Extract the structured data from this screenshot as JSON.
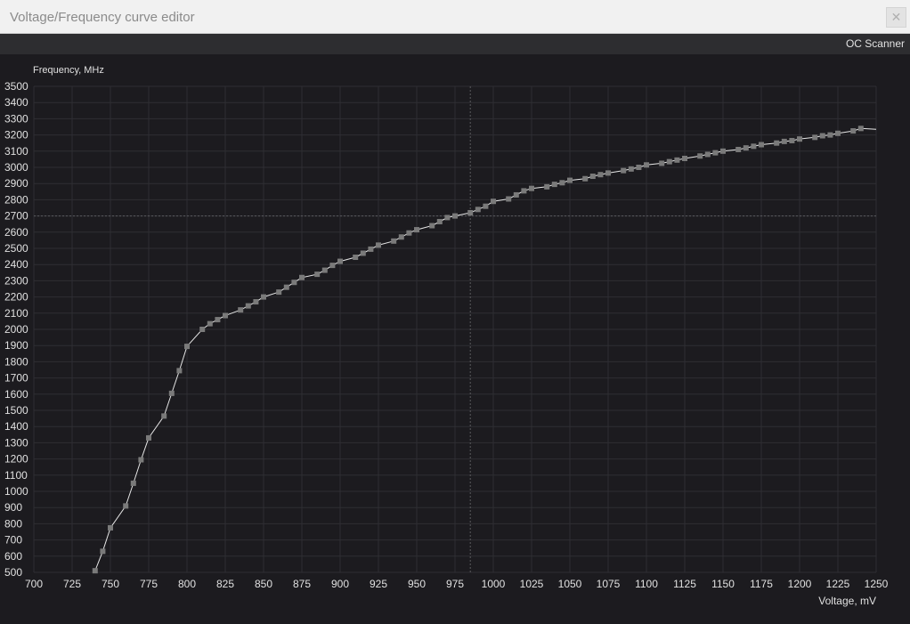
{
  "window": {
    "title": "Voltage/Frequency curve editor",
    "close_icon": "close-icon"
  },
  "toolbar": {
    "oc_scanner_label": "OC Scanner"
  },
  "colors": {
    "background": "#1c1b1f",
    "grid": "#2e2e33",
    "curve": "#e6e6e6",
    "point": "#7a7a7a",
    "crosshair": "#5a5a5e",
    "tick_text": "#e0e0e0"
  },
  "chart_data": {
    "type": "line",
    "ylabel": "Frequency, MHz",
    "xlabel": "Voltage, mV",
    "xlim": [
      700,
      1250
    ],
    "ylim": [
      500,
      3500
    ],
    "x_ticks": [
      700,
      725,
      750,
      775,
      800,
      825,
      850,
      875,
      900,
      925,
      950,
      975,
      1000,
      1025,
      1050,
      1075,
      1100,
      1125,
      1150,
      1175,
      1200,
      1225,
      1250
    ],
    "y_ticks": [
      500,
      600,
      700,
      800,
      900,
      1000,
      1100,
      1200,
      1300,
      1400,
      1500,
      1600,
      1700,
      1800,
      1900,
      2000,
      2100,
      2200,
      2300,
      2400,
      2500,
      2600,
      2700,
      2800,
      2900,
      3000,
      3100,
      3200,
      3300,
      3400,
      3500
    ],
    "grid": true,
    "crosshair": {
      "x": 985,
      "y": 2700
    },
    "series": [
      {
        "x": [
          740,
          745,
          750,
          760,
          765,
          770,
          775,
          785,
          790,
          795,
          800,
          810,
          815,
          820,
          825,
          835,
          840,
          845,
          850,
          860,
          865,
          870,
          875,
          885,
          890,
          895,
          900,
          910,
          915,
          920,
          925,
          935,
          940,
          945,
          950,
          960,
          965,
          970,
          975,
          985,
          990,
          995,
          1000,
          1010,
          1015,
          1020,
          1025,
          1035,
          1040,
          1045,
          1050,
          1060,
          1065,
          1070,
          1075,
          1085,
          1090,
          1095,
          1100,
          1110,
          1115,
          1120,
          1125,
          1135,
          1140,
          1145,
          1150,
          1160,
          1165,
          1170,
          1175,
          1185,
          1190,
          1195,
          1200,
          1210,
          1215,
          1220,
          1225,
          1235,
          1240,
          1250
        ],
        "y": [
          510,
          630,
          775,
          910,
          1050,
          1195,
          1330,
          1465,
          1605,
          1745,
          1895,
          2000,
          2035,
          2060,
          2085,
          2120,
          2145,
          2170,
          2200,
          2230,
          2260,
          2290,
          2320,
          2340,
          2365,
          2395,
          2420,
          2445,
          2470,
          2495,
          2520,
          2545,
          2570,
          2595,
          2615,
          2640,
          2665,
          2690,
          2700,
          2720,
          2740,
          2760,
          2790,
          2805,
          2830,
          2855,
          2870,
          2880,
          2895,
          2905,
          2920,
          2930,
          2945,
          2955,
          2965,
          2980,
          2990,
          3000,
          3015,
          3025,
          3035,
          3045,
          3055,
          3070,
          3080,
          3090,
          3100,
          3110,
          3120,
          3130,
          3140,
          3150,
          3160,
          3165,
          3175,
          3185,
          3195,
          3200,
          3210,
          3225,
          3240,
          3235
        ]
      }
    ]
  }
}
